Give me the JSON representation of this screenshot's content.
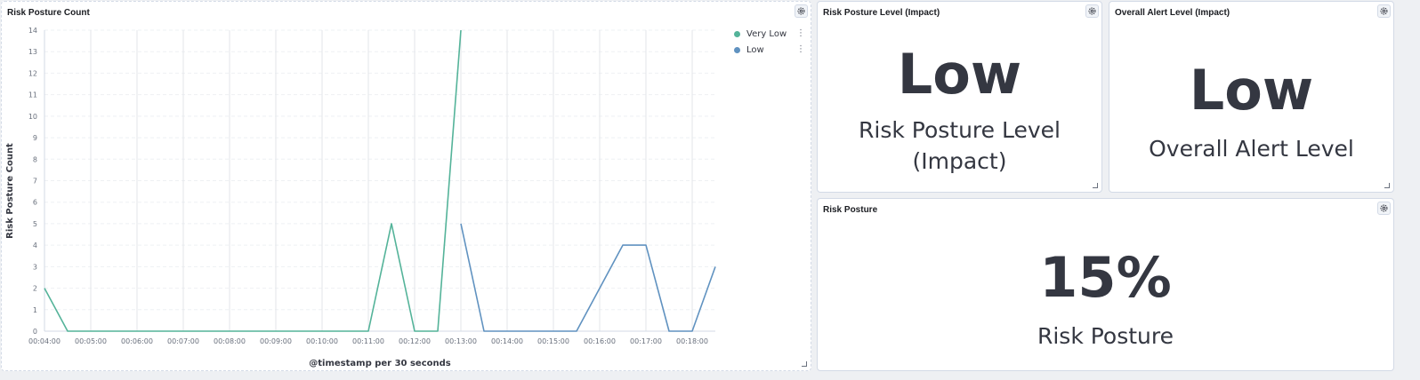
{
  "panels": {
    "risk_count": {
      "title": "Risk Posture Count",
      "settings_icon": "gear-icon"
    },
    "posture_level": {
      "title": "Risk Posture Level (Impact)",
      "value": "Low",
      "label_line1": "Risk Posture Level",
      "label_line2": "(Impact)"
    },
    "alert_level": {
      "title": "Overall Alert Level (Impact)",
      "value": "Low",
      "label": "Overall Alert Level"
    },
    "risk_posture": {
      "title": "Risk Posture",
      "value": "15%",
      "label": "Risk Posture"
    }
  },
  "chart_data": {
    "type": "line",
    "title": "",
    "xlabel": "@timestamp per 30 seconds",
    "ylabel": "Risk Posture Count",
    "ylim": [
      0,
      14
    ],
    "yticks": [
      0,
      1,
      2,
      3,
      4,
      5,
      6,
      7,
      8,
      9,
      10,
      11,
      12,
      13,
      14
    ],
    "x": [
      "00:04:00",
      "00:04:30",
      "00:05:00",
      "00:05:30",
      "00:06:00",
      "00:06:30",
      "00:07:00",
      "00:07:30",
      "00:08:00",
      "00:08:30",
      "00:09:00",
      "00:09:30",
      "00:10:00",
      "00:10:30",
      "00:11:00",
      "00:11:30",
      "00:12:00",
      "00:12:30",
      "00:13:00",
      "00:13:30",
      "00:14:00",
      "00:14:30",
      "00:15:00",
      "00:15:30",
      "00:16:00",
      "00:16:30",
      "00:17:00",
      "00:17:30",
      "00:18:00",
      "00:18:30"
    ],
    "xtick_labels": [
      "00:04:00",
      "00:05:00",
      "00:06:00",
      "00:07:00",
      "00:08:00",
      "00:09:00",
      "00:10:00",
      "00:11:00",
      "00:12:00",
      "00:13:00",
      "00:14:00",
      "00:15:00",
      "00:16:00",
      "00:17:00",
      "00:18:00"
    ],
    "grid": true,
    "legend_position": "top-right",
    "series": [
      {
        "name": "Very Low",
        "color": "#54b399",
        "points": [
          [
            "00:04:00",
            2
          ],
          [
            "00:04:30",
            0
          ],
          [
            "00:05:00",
            0
          ],
          [
            "00:05:30",
            0
          ],
          [
            "00:06:00",
            0
          ],
          [
            "00:06:30",
            0
          ],
          [
            "00:07:00",
            0
          ],
          [
            "00:07:30",
            0
          ],
          [
            "00:08:00",
            0
          ],
          [
            "00:08:30",
            0
          ],
          [
            "00:09:00",
            0
          ],
          [
            "00:09:30",
            0
          ],
          [
            "00:10:00",
            0
          ],
          [
            "00:10:30",
            0
          ],
          [
            "00:11:00",
            0
          ],
          [
            "00:11:30",
            5
          ],
          [
            "00:12:00",
            0
          ],
          [
            "00:12:30",
            0
          ],
          [
            "00:13:00",
            14
          ]
        ]
      },
      {
        "name": "Low",
        "color": "#6092c0",
        "points": [
          [
            "00:13:00",
            5
          ],
          [
            "00:13:30",
            0
          ],
          [
            "00:14:00",
            0
          ],
          [
            "00:14:30",
            0
          ],
          [
            "00:15:00",
            0
          ],
          [
            "00:15:30",
            0
          ],
          [
            "00:16:00",
            2
          ],
          [
            "00:16:30",
            4
          ],
          [
            "00:17:00",
            4
          ],
          [
            "00:17:30",
            0
          ],
          [
            "00:18:00",
            0
          ],
          [
            "00:18:30",
            3
          ]
        ]
      }
    ]
  }
}
